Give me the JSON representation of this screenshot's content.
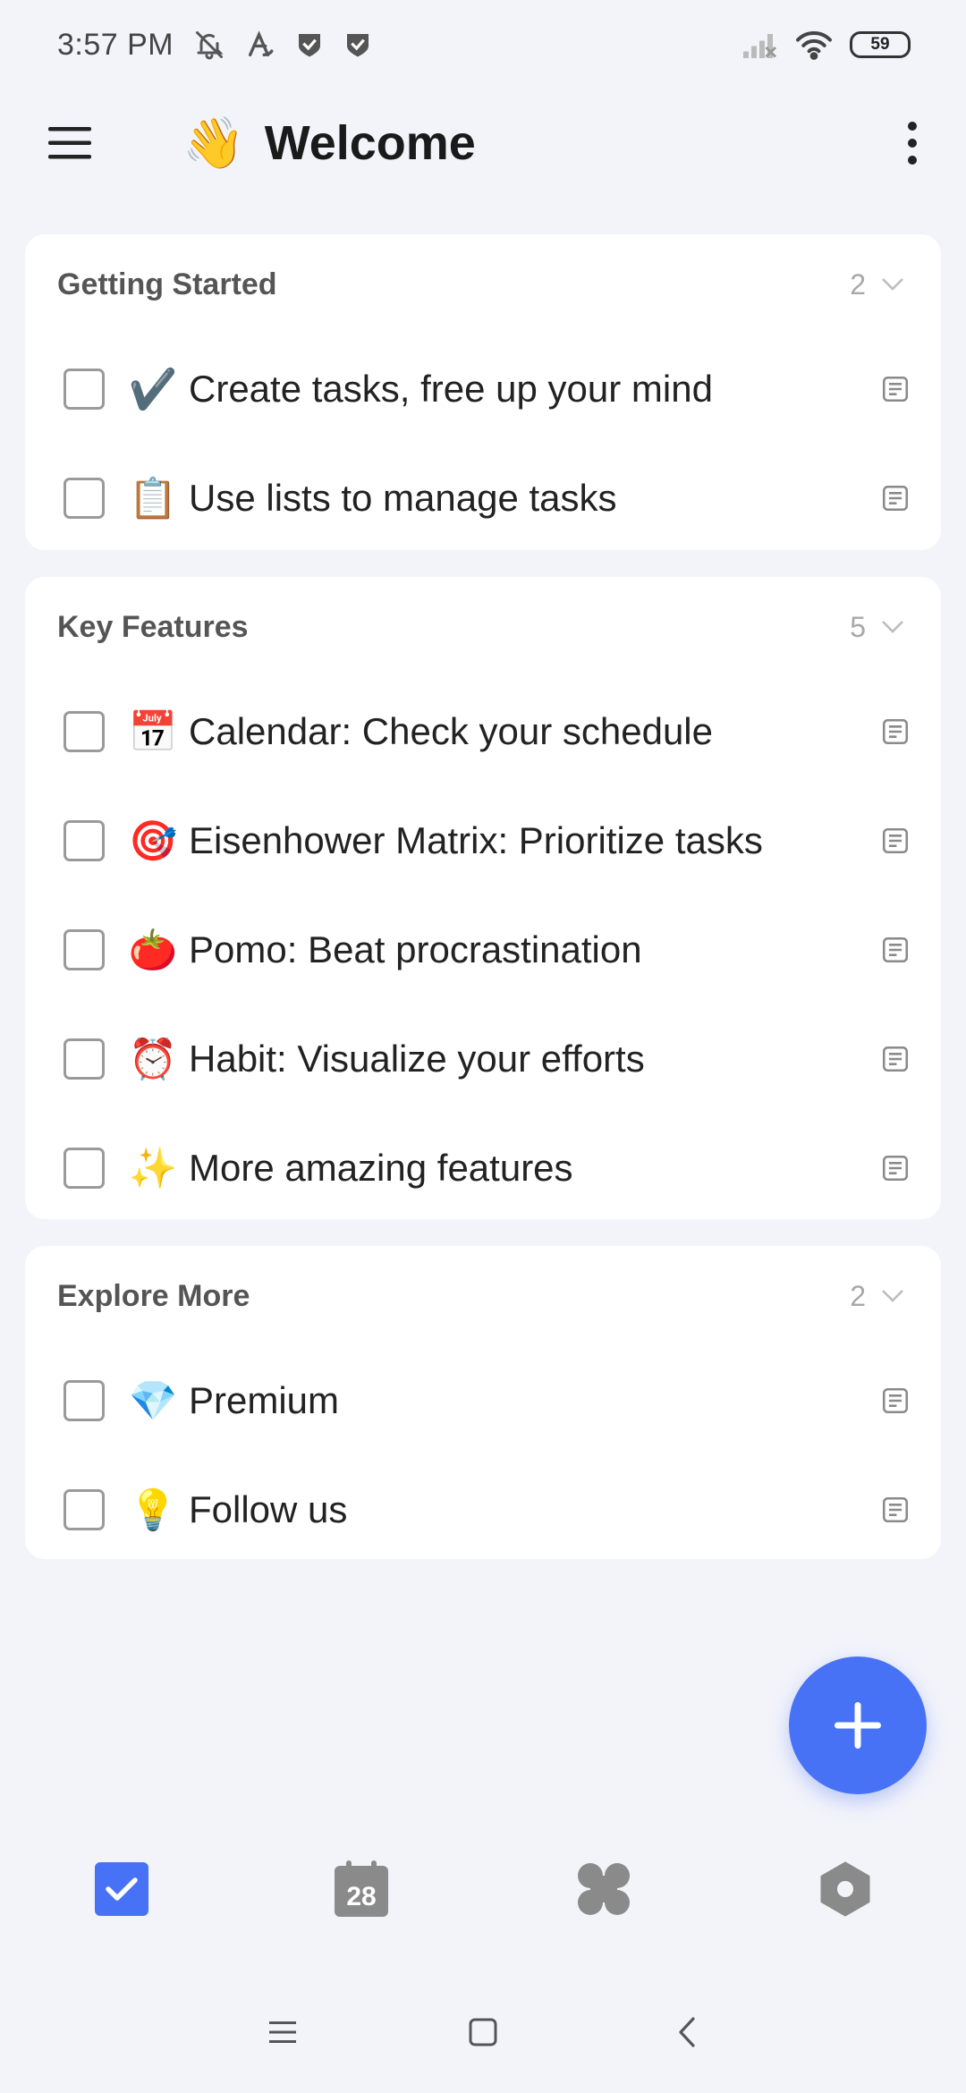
{
  "status_bar": {
    "time": "3:57 PM",
    "battery": "59"
  },
  "header": {
    "emoji": "👋",
    "title": "Welcome"
  },
  "sections": [
    {
      "title": "Getting Started",
      "count": "2",
      "tasks": [
        {
          "emoji": "✔️",
          "text": "Create tasks, free up your mind"
        },
        {
          "emoji": "📋",
          "text": "Use lists to manage tasks"
        }
      ]
    },
    {
      "title": "Key Features",
      "count": "5",
      "tasks": [
        {
          "emoji": "📅",
          "text": "Calendar: Check your schedule"
        },
        {
          "emoji": "🎯",
          "text": "Eisenhower Matrix: Prioritize tasks"
        },
        {
          "emoji": "🍅",
          "text": "Pomo: Beat procrastination"
        },
        {
          "emoji": "⏰",
          "text": "Habit: Visualize your efforts"
        },
        {
          "emoji": "✨",
          "text": "More amazing features"
        }
      ]
    },
    {
      "title": "Explore More",
      "count": "2",
      "tasks": [
        {
          "emoji": "💎",
          "text": "Premium"
        },
        {
          "emoji": "💡",
          "text": "Follow us"
        }
      ]
    }
  ],
  "tabs": {
    "calendar_day": "28"
  },
  "colors": {
    "accent": "#4772f5",
    "background": "#f3f4fa",
    "card": "#ffffff",
    "muted_icon": "#8a8a8a"
  },
  "icons": {
    "menu": "hamburger-icon",
    "more": "more-vertical-icon",
    "fab": "plus-icon",
    "tab_tasks": "checkbox-checked-icon",
    "tab_calendar": "calendar-icon",
    "tab_apps": "four-leaf-grid-icon",
    "tab_settings": "hexagon-settings-icon"
  }
}
